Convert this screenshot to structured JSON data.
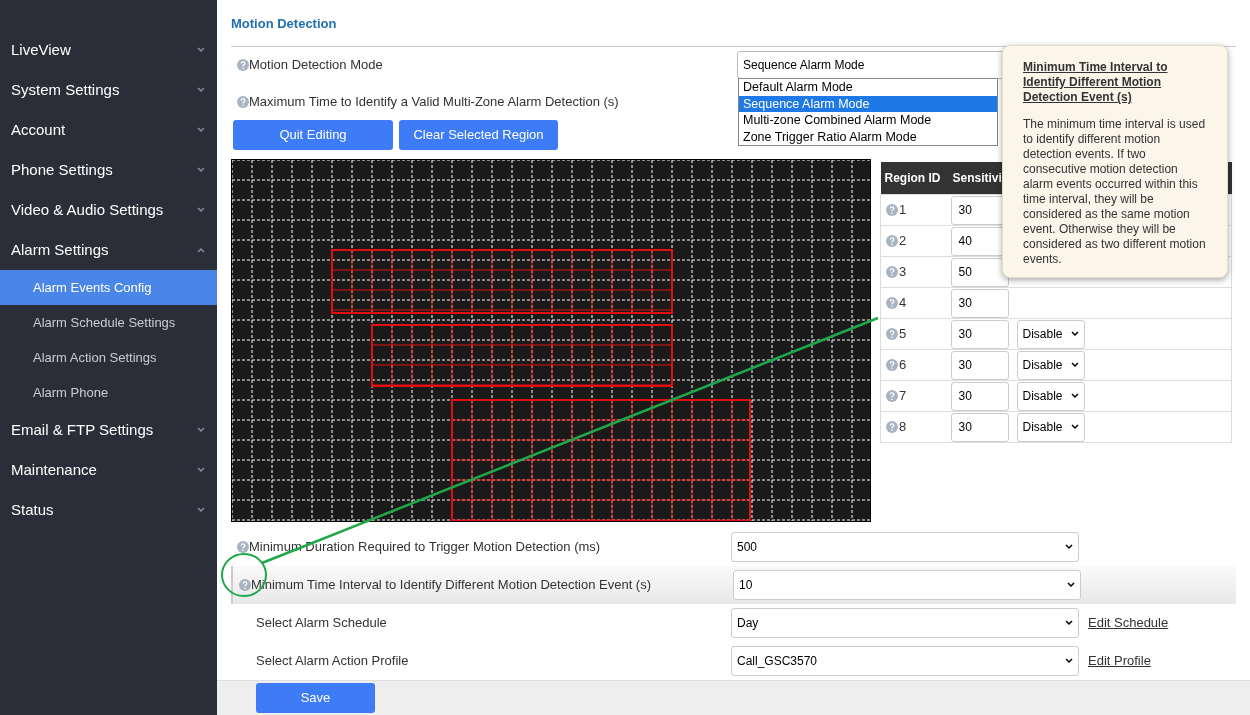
{
  "sidebar": {
    "items": [
      {
        "label": "LiveView",
        "expanded": false
      },
      {
        "label": "System Settings",
        "expanded": false
      },
      {
        "label": "Account",
        "expanded": false
      },
      {
        "label": "Phone Settings",
        "expanded": false
      },
      {
        "label": "Video & Audio Settings",
        "expanded": false
      },
      {
        "label": "Alarm Settings",
        "expanded": true,
        "children": [
          {
            "label": "Alarm Events Config",
            "selected": true
          },
          {
            "label": "Alarm Schedule Settings",
            "selected": false
          },
          {
            "label": "Alarm Action Settings",
            "selected": false
          },
          {
            "label": "Alarm Phone",
            "selected": false
          }
        ]
      },
      {
        "label": "Email & FTP Settings",
        "expanded": false
      },
      {
        "label": "Maintenance",
        "expanded": false
      },
      {
        "label": "Status",
        "expanded": false
      }
    ]
  },
  "section_title": "Motion Detection",
  "mode_field": {
    "label": "Motion Detection Mode",
    "value": "Sequence Alarm Mode",
    "options": [
      {
        "label": "Default Alarm Mode",
        "selected": false
      },
      {
        "label": "Sequence Alarm Mode",
        "selected": true
      },
      {
        "label": "Multi-zone Combined Alarm Mode",
        "selected": false
      },
      {
        "label": "Zone Trigger Ratio Alarm Mode",
        "selected": false
      }
    ]
  },
  "max_time_label": "Maximum Time to Identify a Valid Multi-Zone Alarm Detection (s)",
  "buttons": [
    "Quit Editing",
    "Clear Selected Region"
  ],
  "region_table": {
    "columns": [
      "Region ID",
      "Sensitivi"
    ],
    "rows": [
      {
        "id": "1",
        "sensitivity": "30"
      },
      {
        "id": "2",
        "sensitivity": "40"
      },
      {
        "id": "3",
        "sensitivity": "50"
      },
      {
        "id": "4",
        "sensitivity": "30"
      },
      {
        "id": "5",
        "sensitivity": "30",
        "mode": "Disable"
      },
      {
        "id": "6",
        "sensitivity": "30",
        "mode": "Disable"
      },
      {
        "id": "7",
        "sensitivity": "30",
        "mode": "Disable"
      },
      {
        "id": "8",
        "sensitivity": "30",
        "mode": "Disable"
      }
    ]
  },
  "settings": [
    {
      "label": "Minimum Duration Required to Trigger Motion Detection (ms)",
      "value": "500",
      "help": true,
      "highlighted": false
    },
    {
      "label": "Minimum Time Interval to Identify Different Motion Detection Event (s)",
      "value": "10",
      "help": true,
      "highlighted": true
    },
    {
      "label": "Select Alarm Schedule",
      "value": "Day",
      "help": false,
      "highlighted": false,
      "link": "Edit Schedule"
    },
    {
      "label": "Select Alarm Action Profile",
      "value": "Call_GSC3570",
      "help": false,
      "highlighted": false,
      "link": "Edit Profile"
    }
  ],
  "tooltip": {
    "title": "Minimum Time Interval to Identify Different Motion Detection Event (s)",
    "body": "The minimum time interval is used to identify different motion detection events. If two consecutive motion detection alarm events occurred within this time interval, they will be considered as the same motion event. Otherwise they will be considered as two different motion events."
  },
  "save_button": "Save"
}
